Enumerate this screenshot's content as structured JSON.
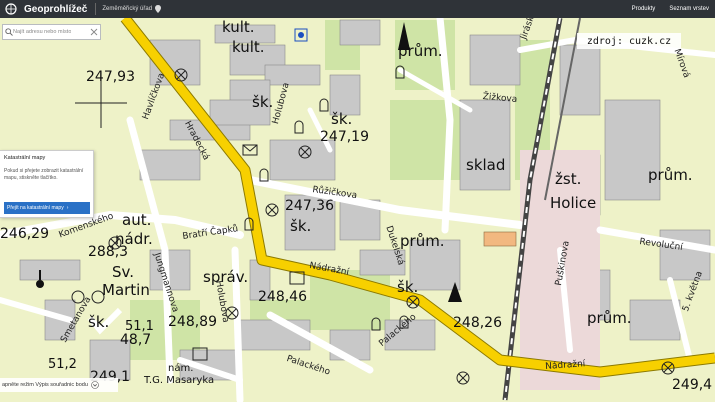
{
  "header": {
    "app_title": "Geoprohlížeč",
    "org": "Zeměměřický úřad",
    "menu": [
      "Produkty",
      "Seznam vrstev"
    ]
  },
  "search": {
    "placeholder": "Najít adresu nebo místo"
  },
  "panel": {
    "title": "Katastrální mapy",
    "text": "Pokud si přejete zobrazit katastrální mapu, stiskněte tlačítko.",
    "button": "Přejít na katastrální mapy"
  },
  "source": "zdroj: cuzk.cz",
  "bottom": {
    "text": "apněte režim Výpis souřadnic bodu"
  },
  "colors": {
    "main_road": "#f7d000",
    "block": "#c8c8c8",
    "green": "#eef2c8",
    "railway": "#555555"
  },
  "map_labels": [
    {
      "text": "kult.",
      "size": 15
    },
    {
      "text": "kult.",
      "size": 15
    },
    {
      "text": "prům.",
      "size": 15
    },
    {
      "text": "247,93",
      "size": 14
    },
    {
      "text": "šk.",
      "size": 15
    },
    {
      "text": "šk.",
      "size": 15
    },
    {
      "text": "247,19",
      "size": 14
    },
    {
      "text": "sklad",
      "size": 15
    },
    {
      "text": "žst.",
      "size": 15
    },
    {
      "text": "Holice",
      "size": 15
    },
    {
      "text": "prům.",
      "size": 15
    },
    {
      "text": "247,36",
      "size": 14
    },
    {
      "text": "šk.",
      "size": 15
    },
    {
      "text": "aut.",
      "size": 15
    },
    {
      "text": "nádr.",
      "size": 15
    },
    {
      "text": "246,29",
      "size": 14
    },
    {
      "text": "prům.",
      "size": 15
    },
    {
      "text": "288,3",
      "size": 14
    },
    {
      "text": "Sv.",
      "size": 15
    },
    {
      "text": "Martin",
      "size": 15
    },
    {
      "text": "správ.",
      "size": 15
    },
    {
      "text": "248,46",
      "size": 14
    },
    {
      "text": "šk.",
      "size": 15
    },
    {
      "text": "248,26",
      "size": 14
    },
    {
      "text": "prům.",
      "size": 15
    },
    {
      "text": "šk.",
      "size": 15
    },
    {
      "text": "248,89",
      "size": 14
    },
    {
      "text": "51,1",
      "size": 13
    },
    {
      "text": "48,7",
      "size": 14
    },
    {
      "text": "51,2",
      "size": 13
    },
    {
      "text": "249,1",
      "size": 14
    },
    {
      "text": "249,4",
      "size": 14
    },
    {
      "text": "nám.",
      "size": 10
    },
    {
      "text": "T.G. Masaryka",
      "size": 10
    }
  ],
  "streets": [
    "Hradecká",
    "Havlíčkova",
    "Holubova",
    "Růžičkova",
    "Bratří Čapků",
    "Jungmannova",
    "Nádražní",
    "Nádražní",
    "Palackého",
    "Palackého",
    "Dukelská",
    "Žižkova",
    "Jiráskova",
    "Mírová",
    "Revoluční",
    "Puškinova",
    "5. května",
    "Komenského",
    "Holubova",
    "Smetanova"
  ]
}
